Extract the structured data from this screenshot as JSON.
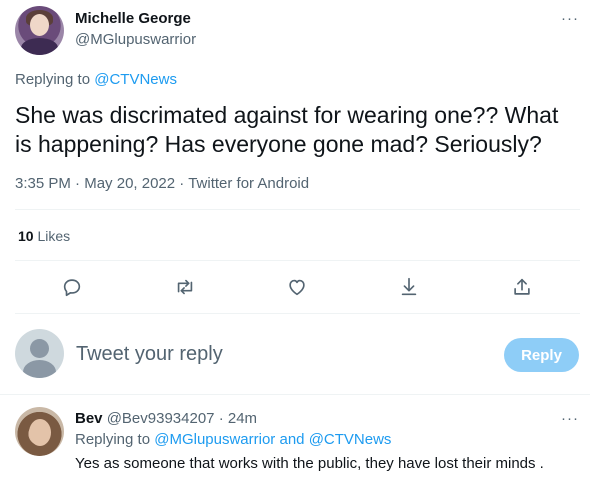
{
  "main_tweet": {
    "author_name": "Michelle George",
    "author_handle": "@MGlupuswarrior",
    "more_label": "···",
    "replying_prefix": "Replying to",
    "replying_to": "@CTVNews",
    "text": "She was discrimated against for wearing one?? What is happening? Has everyone gone mad? Seriously?",
    "time": "3:35 PM",
    "date": "May 20, 2022",
    "source": "Twitter for Android",
    "separator": "·",
    "likes_count": "10",
    "likes_label": "Likes"
  },
  "actions": {
    "reply_icon": "reply-icon",
    "retweet_icon": "retweet-icon",
    "like_icon": "heart-icon",
    "bookmark_icon": "bookmark-icon",
    "share_icon": "share-icon"
  },
  "composer": {
    "placeholder": "Tweet your reply",
    "button_label": "Reply"
  },
  "reply_tweet": {
    "author_name": "Bev",
    "author_handle": "@Bev93934207",
    "time_ago": "24m",
    "separator": "·",
    "more_label": "···",
    "replying_prefix": "Replying to",
    "replying_to_1": "@MGlupuswarrior",
    "and_word": "and",
    "replying_to_2": "@CTVNews",
    "text": "Yes as someone that works with the public, they have lost their minds ."
  },
  "colors": {
    "accent": "#1d9bf0",
    "reply_button_disabled": "#8ecdf7",
    "secondary_text": "#536471",
    "divider": "#eff3f4"
  }
}
